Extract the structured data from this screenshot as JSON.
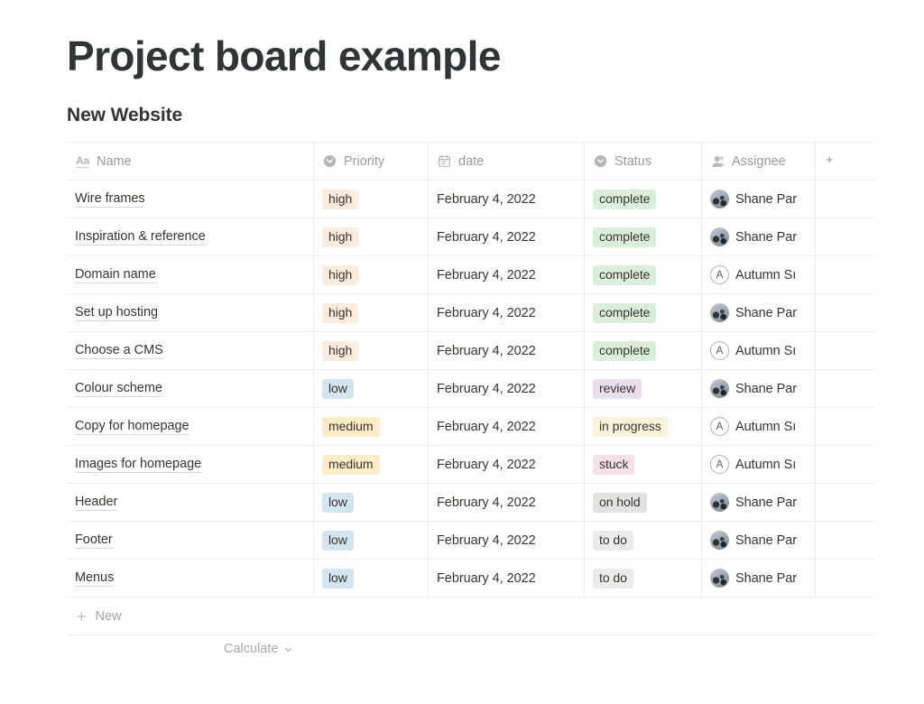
{
  "page_title": "Project board example",
  "database_title": "New Website",
  "table": {
    "columns": [
      {
        "key": "name",
        "label": "Name",
        "icon": "text-aa-icon"
      },
      {
        "key": "priority",
        "label": "Priority",
        "icon": "select-icon"
      },
      {
        "key": "date",
        "label": "date",
        "icon": "calendar-icon"
      },
      {
        "key": "status",
        "label": "Status",
        "icon": "select-icon"
      },
      {
        "key": "assignee",
        "label": "Assignee",
        "icon": "person-icon"
      }
    ],
    "add_column_label": "+",
    "rows": [
      {
        "name": "Wire frames",
        "priority": "high",
        "date": "February 4, 2022",
        "status": "complete",
        "assignee": "Shane Par",
        "assignee_avatar": "photo"
      },
      {
        "name": "Inspiration & reference",
        "priority": "high",
        "date": "February 4, 2022",
        "status": "complete",
        "assignee": "Shane Par",
        "assignee_avatar": "photo"
      },
      {
        "name": "Domain name",
        "priority": "high",
        "date": "February 4, 2022",
        "status": "complete",
        "assignee": "Autumn Sı",
        "assignee_avatar": "A"
      },
      {
        "name": "Set up hosting",
        "priority": "high",
        "date": "February 4, 2022",
        "status": "complete",
        "assignee": "Shane Par",
        "assignee_avatar": "photo"
      },
      {
        "name": "Choose a CMS",
        "priority": "high",
        "date": "February 4, 2022",
        "status": "complete",
        "assignee": "Autumn Sı",
        "assignee_avatar": "A"
      },
      {
        "name": "Colour scheme",
        "priority": "low",
        "date": "February 4, 2022",
        "status": "review",
        "assignee": "Shane Par",
        "assignee_avatar": "photo"
      },
      {
        "name": "Copy for homepage",
        "priority": "medium",
        "date": "February 4, 2022",
        "status": "in progress",
        "assignee": "Autumn Sı",
        "assignee_avatar": "A"
      },
      {
        "name": "Images for homepage",
        "priority": "medium",
        "date": "February 4, 2022",
        "status": "stuck",
        "assignee": "Autumn Sı",
        "assignee_avatar": "A"
      },
      {
        "name": "Header",
        "priority": "low",
        "date": "February 4, 2022",
        "status": "on hold",
        "assignee": "Shane Par",
        "assignee_avatar": "photo"
      },
      {
        "name": "Footer",
        "priority": "low",
        "date": "February 4, 2022",
        "status": "to do",
        "assignee": "Shane Par",
        "assignee_avatar": "photo"
      },
      {
        "name": "Menus",
        "priority": "low",
        "date": "February 4, 2022",
        "status": "to do",
        "assignee": "Shane Par",
        "assignee_avatar": "photo"
      }
    ],
    "new_row_label": "New",
    "new_row_icon": "+"
  },
  "footer": {
    "calculate_label": "Calculate",
    "calculate_icon": "chevron-down-icon"
  },
  "tag_colors": {
    "high": {
      "bg": "#fbecdd",
      "fg": "#37352f"
    },
    "medium": {
      "bg": "#fdecc8",
      "fg": "#37352f"
    },
    "low": {
      "bg": "#d3e5ef",
      "fg": "#37352f"
    },
    "complete": {
      "bg": "#dbeddb",
      "fg": "#37352f"
    },
    "review": {
      "bg": "#e8deee",
      "fg": "#37352f"
    },
    "in progress": {
      "bg": "#fbf3db",
      "fg": "#37352f"
    },
    "stuck": {
      "bg": "#f5e0e9",
      "fg": "#37352f"
    },
    "on hold": {
      "bg": "#e3e2e0",
      "fg": "#37352f"
    },
    "to do": {
      "bg": "#ebebea",
      "fg": "#37352f"
    }
  }
}
